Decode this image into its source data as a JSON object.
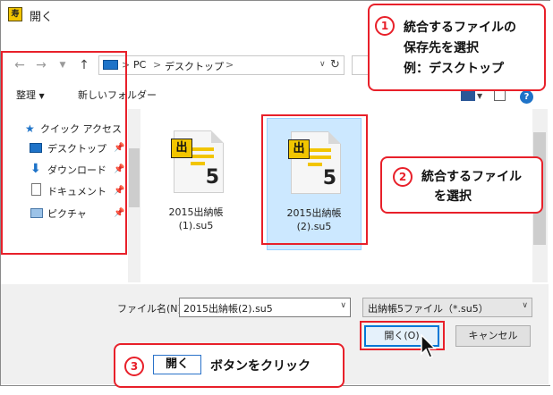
{
  "window": {
    "title": "開く",
    "app_icon": "susi-app-icon"
  },
  "address": {
    "segments": [
      "PC",
      "デスクトップ"
    ],
    "separators": [
      ">",
      ">",
      ">"
    ]
  },
  "toolbar": {
    "organize_label": "整理",
    "new_folder_label": "新しいフォルダー"
  },
  "nav_pane": {
    "items": [
      {
        "label": "クイック アクセス",
        "icon": "star-icon"
      },
      {
        "label": "デスクトップ",
        "icon": "desktop-icon",
        "pinned": true
      },
      {
        "label": "ダウンロード",
        "icon": "download-icon",
        "pinned": true
      },
      {
        "label": "ドキュメント",
        "icon": "document-icon",
        "pinned": true
      },
      {
        "label": "ピクチャ",
        "icon": "pictures-icon",
        "pinned": true
      }
    ]
  },
  "files": [
    {
      "name_line1": "2015出納帳",
      "name_line2": "(1).su5",
      "badge": "出",
      "number": "5",
      "selected": false
    },
    {
      "name_line1": "2015出納帳",
      "name_line2": "(2).su5",
      "badge": "出",
      "number": "5",
      "selected": true
    }
  ],
  "bottom": {
    "filename_label": "ファイル名(N):",
    "filename_value": "2015出納帳(2).su5",
    "filetype_value": "出納帳5ファイル（*.su5）",
    "open_button": "開く(O)",
    "cancel_button": "キャンセル"
  },
  "callouts": {
    "step1": {
      "number": "1",
      "line1": "統合するファイルの",
      "line2": "保存先を選択",
      "line3": "例：デスクトップ"
    },
    "step2": {
      "number": "2",
      "line1": "統合するファイル",
      "line2": "を選択"
    },
    "step3": {
      "number": "3",
      "button_text": "開く",
      "text": "ボタンをクリック"
    }
  },
  "colors": {
    "annotation_red": "#e8202a",
    "selection_blue": "#cce8ff",
    "accent_blue": "#0078d7",
    "badge_yellow": "#f2c500"
  }
}
